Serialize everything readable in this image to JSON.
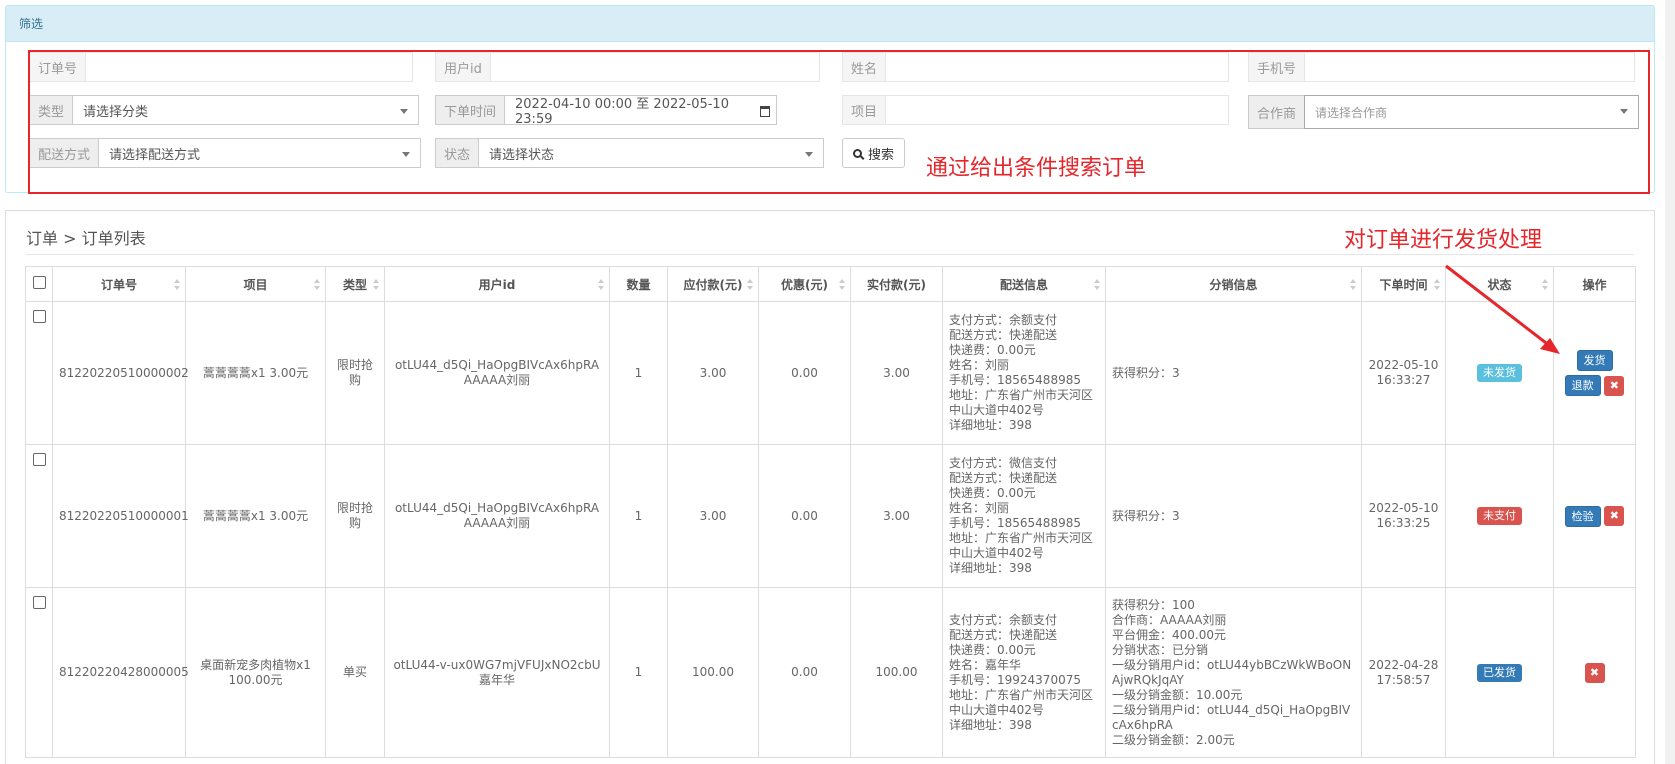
{
  "filter": {
    "heading": "筛选",
    "order_no_label": "订单号",
    "user_id_label": "用户id",
    "name_label": "姓名",
    "phone_label": "手机号",
    "type_label": "类型",
    "type_value": "请选择分类",
    "order_time_label": "下单时间",
    "order_time_value": "2022-04-10 00:00 至 2022-05-10 23:59",
    "item_label": "项目",
    "partner_label": "合作商",
    "partner_placeholder": "请选择合作商",
    "delivery_label": "配送方式",
    "delivery_value": "请选择配送方式",
    "status_label": "状态",
    "status_value": "请选择状态",
    "search_label": "搜索"
  },
  "annotations": {
    "search": "通过给出条件搜索订单",
    "ship": "对订单进行发货处理"
  },
  "colors": {
    "annotation": "#e5262b",
    "info": "#5bc0de",
    "danger": "#d9534f",
    "primary": "#337ab7"
  },
  "breadcrumb": "订单 > 订单列表",
  "table": {
    "headers": [
      "订单号",
      "项目",
      "类型",
      "用户id",
      "数量",
      "应付款(元)",
      "优惠(元)",
      "实付款(元)",
      "配送信息",
      "分销信息",
      "下单时间",
      "状态",
      "操作"
    ],
    "rows": [
      {
        "order_no": "81220220510000002",
        "item": "蒿蒿蒿蒿x1 3.00元",
        "type": "限时抢购",
        "user_id": "otLU44_d5Qi_HaOpgBIVcAx6hpRAAAAAA刘丽",
        "qty": "1",
        "payable": "3.00",
        "discount": "0.00",
        "paid": "3.00",
        "delivery": [
          "支付方式：余额支付",
          "配送方式：快递配送",
          "快递费：0.00元",
          "姓名：刘丽",
          "手机号：18565488985",
          "地址：广东省广州市天河区中山大道中402号",
          "详细地址：398"
        ],
        "distribution": [
          "获得积分：3"
        ],
        "time": "2022-05-10 16:33:27",
        "status": "未发货",
        "btn_ship": "发货",
        "btn_refund": "退款",
        "btn_delete": "✖"
      },
      {
        "order_no": "81220220510000001",
        "item": "蒿蒿蒿蒿x1 3.00元",
        "type": "限时抢购",
        "user_id": "otLU44_d5Qi_HaOpgBIVcAx6hpRAAAAAA刘丽",
        "qty": "1",
        "payable": "3.00",
        "discount": "0.00",
        "paid": "3.00",
        "delivery": [
          "支付方式：微信支付",
          "配送方式：快递配送",
          "快递费：0.00元",
          "姓名：刘丽",
          "手机号：18565488985",
          "地址：广东省广州市天河区中山大道中402号",
          "详细地址：398"
        ],
        "distribution": [
          "获得积分：3"
        ],
        "time": "2022-05-10 16:33:25",
        "status": "未支付",
        "btn_check": "检验",
        "btn_delete": "✖"
      },
      {
        "order_no": "81220220428000005",
        "item": "桌面新宠多肉植物x1 100.00元",
        "type": "单买",
        "user_id": "otLU44-v-ux0WG7mjVFUJxNO2cbU嘉年华",
        "qty": "1",
        "payable": "100.00",
        "discount": "0.00",
        "paid": "100.00",
        "delivery": [
          "支付方式：余额支付",
          "配送方式：快递配送",
          "快递费：0.00元",
          "姓名：嘉年华",
          "手机号：19924370075",
          "地址：广东省广州市天河区中山大道中402号",
          "详细地址：398"
        ],
        "distribution": [
          "获得积分：100",
          "合作商：AAAAA刘丽",
          "平台佣金：400.00元",
          "分销状态：已分销",
          "一级分销用户id：otLU44ybBCzWkWBoONAjwRQkJqAY",
          "一级分销金额：10.00元",
          "二级分销用户id：otLU44_d5Qi_HaOpgBIVcAx6hpRA",
          "二级分销金额：2.00元"
        ],
        "time": "2022-04-28 17:58:57",
        "status": "已发货",
        "btn_delete": "✖"
      }
    ]
  }
}
